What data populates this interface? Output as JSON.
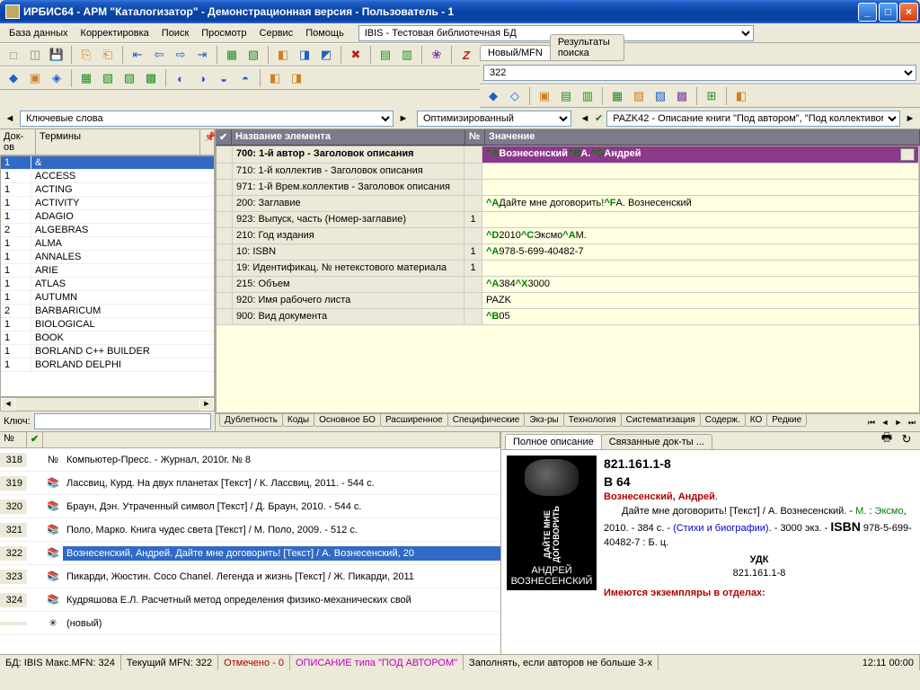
{
  "window_title": "ИРБИС64 - АРМ \"Каталогизатор\" - Демонстрационная версия - Пользователь - 1",
  "menu": [
    "База данных",
    "Корректировка",
    "Поиск",
    "Просмотр",
    "Сервис",
    "Помощь"
  ],
  "db_selector": "IBIS - Тестовая библиотечная БД",
  "tabs_top": {
    "new_mfn": "Новый/MFN",
    "results": "Результаты поиска"
  },
  "mfn_field": "322",
  "combo_left": "Ключевые слова",
  "combo_mid": "Оптимизированный",
  "combo_right": "PAZK42 - Описание книги \"Под автором\", \"Под коллективом\" или \"Под заглавием\"",
  "term_headers": {
    "doc": "Док-ов",
    "term": "Термины"
  },
  "terms": [
    {
      "n": "1",
      "t": "&"
    },
    {
      "n": "1",
      "t": "ACCESS"
    },
    {
      "n": "1",
      "t": "ACTING"
    },
    {
      "n": "1",
      "t": "ACTIVITY"
    },
    {
      "n": "1",
      "t": "ADAGIO"
    },
    {
      "n": "2",
      "t": "ALGEBRAS"
    },
    {
      "n": "1",
      "t": "ALMA"
    },
    {
      "n": "1",
      "t": "ANNALES"
    },
    {
      "n": "1",
      "t": "ARIE"
    },
    {
      "n": "1",
      "t": "ATLAS"
    },
    {
      "n": "1",
      "t": "AUTUMN"
    },
    {
      "n": "2",
      "t": "BARBARICUM"
    },
    {
      "n": "1",
      "t": "BIOLOGICAL"
    },
    {
      "n": "1",
      "t": "BOOK"
    },
    {
      "n": "1",
      "t": "BORLAND C++ BUILDER"
    },
    {
      "n": "1",
      "t": "BORLAND DELPHI"
    }
  ],
  "key_label": "Ключ:",
  "grid_headers": {
    "name": "Название элемента",
    "num": "№",
    "value": "Значение"
  },
  "fields": [
    {
      "name": "700: 1-й  автор - Заголовок описания",
      "num": "",
      "val": "^AВознесенский^BА.^GАндрей",
      "hl": true,
      "sel": true
    },
    {
      "name": "710: 1-й коллектив - Заголовок описания",
      "num": "",
      "val": ""
    },
    {
      "name": "971: 1-й Врем.коллектив - Заголовок описания",
      "num": "",
      "val": ""
    },
    {
      "name": "200: Заглавие",
      "num": "",
      "val": "^AДайте мне договорить!^FА. Вознесенский"
    },
    {
      "name": "923: Выпуск, часть (Номер-заглавие)",
      "num": "1",
      "val": ""
    },
    {
      "name": "210: Год издания",
      "num": "",
      "val": "^D2010^CЭксмо^AМ."
    },
    {
      "name": "10: ISBN",
      "num": "1",
      "val": "^A978-5-699-40482-7"
    },
    {
      "name": "19: Идентификац. № нетекстового материала",
      "num": "1",
      "val": ""
    },
    {
      "name": "215: Объем",
      "num": "",
      "val": "^A384^X3000"
    },
    {
      "name": "920: Имя рабочего листа",
      "num": "",
      "val": "PAZK"
    },
    {
      "name": "900: Вид документа",
      "num": "",
      "val": "^B05"
    }
  ],
  "bottom_tabs": [
    "Дублетность",
    "Коды",
    "Основное БО",
    "Расширенное",
    "Специфические",
    "Экз-ры",
    "Технология",
    "Систематизация",
    "Содерж.",
    "КО",
    "Редкие"
  ],
  "records": [
    {
      "n": "318",
      "t": "Компьютер-Пресс. - Журнал, 2010г. № 8",
      "icon": "№"
    },
    {
      "n": "319",
      "t": "Лассвиц, Курд. На двух планетах [Текст] / К. Лассвиц, 2011. - 544 с."
    },
    {
      "n": "320",
      "t": "Браун, Дэн. Утраченный символ [Текст] / Д. Браун, 2010. - 544 с."
    },
    {
      "n": "321",
      "t": "Поло, Марко. Книга чудес света [Текст] / М. Поло, 2009. - 512 с."
    },
    {
      "n": "322",
      "t": "Вознесенский, Андрей. Дайте мне договорить! [Текст] / А. Вознесенский, 20",
      "sel": true
    },
    {
      "n": "323",
      "t": "Пикарди, Жюстин. Coco Chanel. Легенда и жизнь [Текст] / Ж. Пикарди, 2011"
    },
    {
      "n": "324",
      "t": "Кудряшова Е.Л. Расчетный метод определения физико-механических свой"
    },
    {
      "n": "",
      "t": "(новый)",
      "new": true
    }
  ],
  "desc_tabs": [
    "Полное описание",
    "Связанные док-ты ..."
  ],
  "desc": {
    "classif": "821.161.1-8",
    "cutter": "В 64",
    "author": "Вознесенский, Андрей",
    "title_part": "Дайте мне договорить! [Текст] / А. Вознесенский.",
    "place": "М.",
    "publisher": "Эксмо",
    "year": "2010",
    "pages": "384 с.",
    "series": "(Стихи и биографии)",
    "copies": "3000 экз.",
    "isbn_label": "ISBN",
    "isbn": "978-5-699-40482-7 : Б. ц.",
    "udk_label": "УДК",
    "udk": "821.161.1-8",
    "holdings": "Имеются экземпляры в отделах:",
    "cover_author": "АНДРЕЙ ВОЗНЕСЕНСКИЙ",
    "cover_title": "ДАЙТЕ МНЕ ДОГОВОРИТЬ"
  },
  "status": {
    "db": "БД: IBIS Макс.MFN: 324",
    "cur": "Текущий MFN: 322",
    "marked": "Отмечено - 0",
    "desc": "ОПИСАНИЕ типа \"ПОД АВТОРОМ\"",
    "hint": "Заполнять, если авторов не больше 3-х",
    "time": "12:11  00:00"
  }
}
